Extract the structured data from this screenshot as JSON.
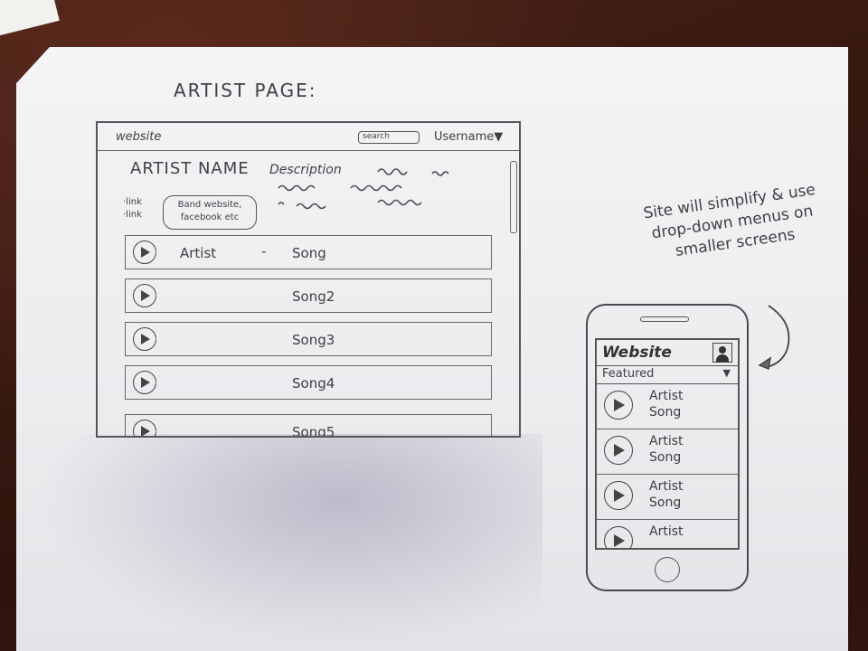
{
  "sketch_title": "ARTIST PAGE:",
  "desktop": {
    "brand": "website",
    "search_placeholder": "search",
    "username": "Username▼",
    "artist_name": "ARTIST NAME",
    "description_label": "Description",
    "links": [
      "·link",
      "·link"
    ],
    "links_bubble": "Band website,\nfacebook etc",
    "rows": [
      {
        "artist": "Artist",
        "dash": "-",
        "song": "Song"
      },
      {
        "artist": "",
        "dash": "",
        "song": "Song2"
      },
      {
        "artist": "",
        "dash": "",
        "song": "Song3"
      },
      {
        "artist": "",
        "dash": "",
        "song": "Song4"
      },
      {
        "artist": "",
        "dash": "",
        "song": "Song5"
      }
    ]
  },
  "mobile": {
    "note": "Site will simplify & use drop-down menus on smaller screens",
    "brand": "Website",
    "dropdown_label": "Featured",
    "dropdown_chevron": "▼",
    "items": [
      {
        "artist": "Artist",
        "song": "Song"
      },
      {
        "artist": "Artist",
        "song": "Song"
      },
      {
        "artist": "Artist",
        "song": "Song"
      },
      {
        "artist": "Artist",
        "song": ""
      }
    ]
  },
  "colors": {
    "pencil": "#3f3f44",
    "paper": "#ececef",
    "table": "#3a1a12"
  },
  "icons": {
    "play": "play-icon",
    "avatar": "user-avatar-icon",
    "chevron": "chevron-down-icon"
  }
}
